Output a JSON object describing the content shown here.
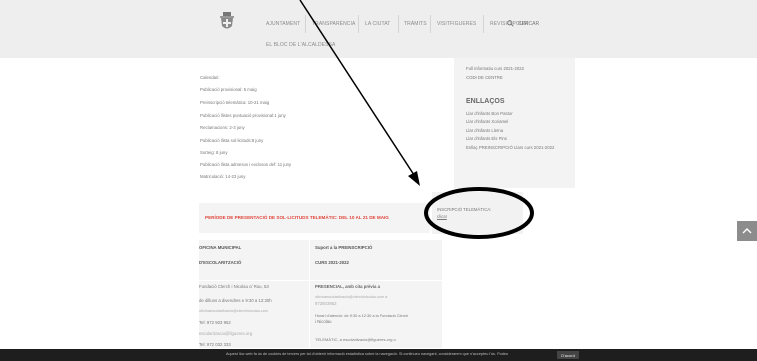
{
  "header": {
    "nav": [
      "AJUNTAMENT",
      "TRANSPARÈNCIA",
      "LA CIUTAT",
      "TRÀMITS",
      "VISITFIGUERES",
      "REVISIÓ POUM"
    ],
    "nav2": "EL BLOC DE L'ALCALDESSA",
    "search_label": "CERCAR"
  },
  "calendar": {
    "title": "Calendari:",
    "lines": [
      "Publicació provisional: 5 maig",
      "Preinscripció telemàtica: 10-21 maig",
      "Publicació llistes puntuació provisional:1 juny",
      "Reclamacions: 2-3 juny",
      "Publicació llista sol·licituds:8 juny",
      "Sorteig: 8 juny",
      "Publicació llista admesos i exclosos def: 11 juny",
      "Matriculació: 14-23 juny"
    ]
  },
  "sidebar": {
    "docs": [
      "Full informatiu curs 2021-2022",
      "CODI DE CENTRE"
    ],
    "links_title": "ENLLAÇOS",
    "links": [
      "Llar d'infants Bon Pastor",
      "Llar d'infants Xoriamel",
      "Llar d'infants Lleïna",
      "Llar d'infants Els Pins",
      "Enllaç PREINSCRIPCIÓ Llars curs 2021-2022"
    ]
  },
  "notice": {
    "red": "PERÍODE DE PRESENTACIÓ DE SOL·LICITUDS TELEMÀTIC: DEL 10 AL 21 DE MAIG",
    "info": "INSCRIPCIÓ TELEMÀTICA:",
    "info_link": "clica!"
  },
  "table": {
    "col1_title": [
      "OFICINA MUNICIPAL",
      "D'ESCOLARITZACIÓ"
    ],
    "col2_title": [
      "Suport a la PREINSCRIPCIÓ",
      "CURS 2021-2022"
    ],
    "col1": [
      "Fundació Clerch i Nicolau c/ Rou, 53",
      "de dilluns a divendres e 9:30 a 12:30h",
      "oficinaescolaritzacio@clerchinicolau.com",
      "Tel: 972 503 952",
      "escolaritzacio@figueres.org",
      "Tel: 972 032 333"
    ],
    "col2": [
      "PRESENCIAL, amb cita prèvia a",
      "oficinaescolaritzacio@clerchinicolau.com   a",
      "972503952",
      "Horari d'atenció: de 9:30 a 12:30 a la Fundació Clerch",
      "i Nicolau",
      "TELEMÀTIC, a escolaritzacio@figueres.org o"
    ]
  },
  "cookie": {
    "text": "Aquest lloc web fa ús de cookies de tercers per tal d'obtenir informació estadística sobre la navegació. Si continueu navegant, considerarem que n'accepteu l'ús. Podeu",
    "button": "D'acord"
  }
}
